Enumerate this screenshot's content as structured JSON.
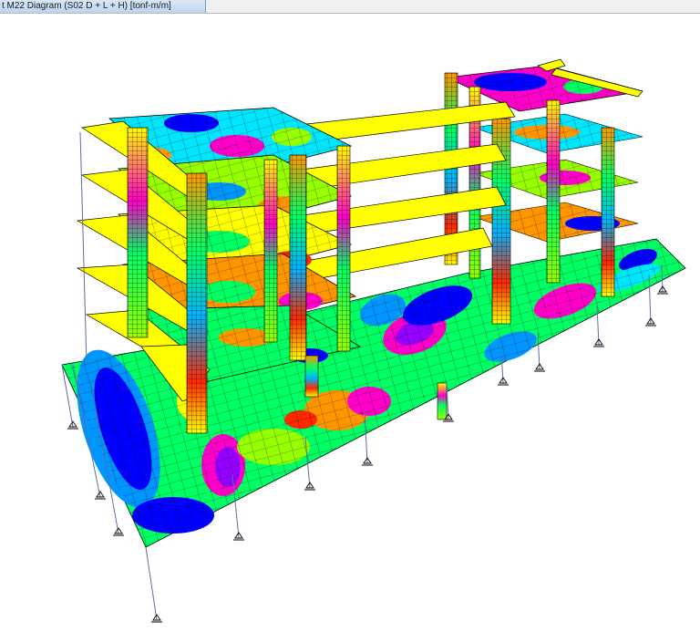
{
  "window": {
    "title": "t M22 Diagram   (S02 D + L + H)  [tonf-m/m]"
  },
  "viewport": {
    "description_view": "3D extruded structural model with shell moment contour",
    "contour_colors": [
      "#0000ff",
      "#0096ff",
      "#00e6ff",
      "#00ff64",
      "#96ff00",
      "#ffff00",
      "#ff9600",
      "#ff2800",
      "#ff00c8",
      "#9600ff"
    ],
    "beam_color": "#ffff00",
    "support_icon": "pin-support-icon"
  }
}
